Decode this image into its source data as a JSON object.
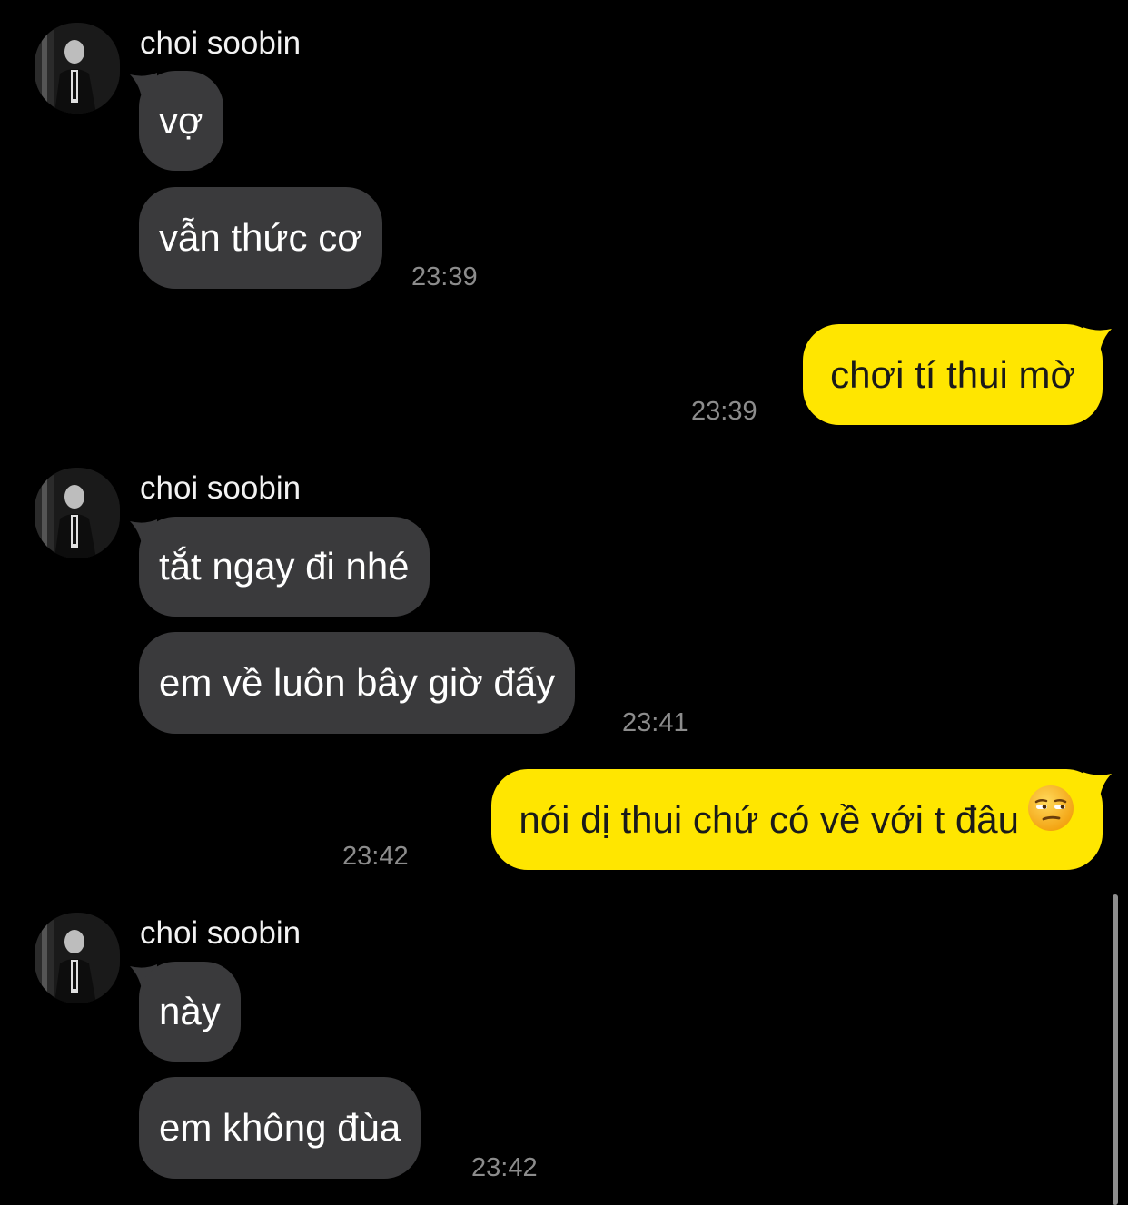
{
  "chat": {
    "groups": [
      {
        "sender": "choi soobin",
        "messages": [
          "vợ",
          "vẫn thức cơ"
        ],
        "time": "23:39"
      },
      {
        "sender": "me",
        "messages": [
          "chơi tí thui mờ"
        ],
        "time": "23:39"
      },
      {
        "sender": "choi soobin",
        "messages": [
          "tắt ngay đi nhé",
          "em về luôn bây giờ đấy"
        ],
        "time": "23:41"
      },
      {
        "sender": "me",
        "messages": [
          "nói dị thui chứ có về với t đâu"
        ],
        "emoji": "unamused-face-icon",
        "time": "23:42"
      },
      {
        "sender": "choi soobin",
        "messages": [
          "này",
          "em không đùa"
        ],
        "time": "23:42"
      }
    ]
  },
  "colors": {
    "background": "#000000",
    "incoming_bubble": "#3a3a3c",
    "outgoing_bubble": "#ffe600",
    "timestamp": "#8c8c8c"
  }
}
